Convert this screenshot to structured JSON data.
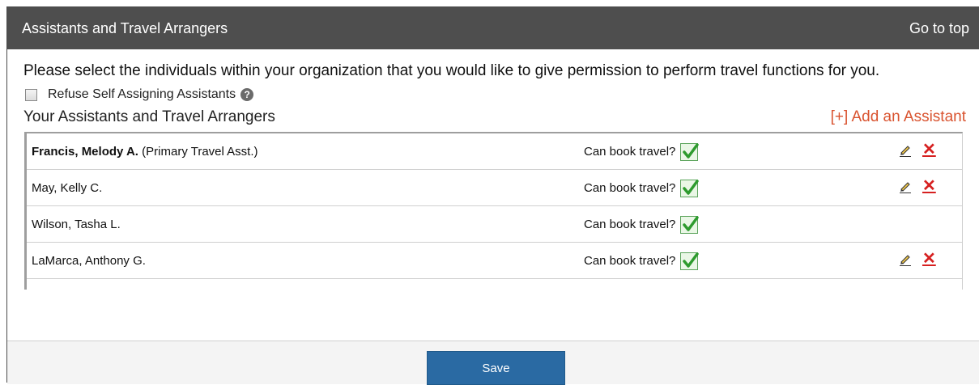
{
  "header": {
    "title": "Assistants and Travel Arrangers",
    "go_to_top": "Go to top"
  },
  "intro_text": "Please select the individuals within your organization that you would like to give permission to perform travel functions for you.",
  "refuse": {
    "label": "Refuse Self Assigning Assistants",
    "checked": false,
    "help_glyph": "?"
  },
  "section": {
    "title": "Your Assistants and Travel Arrangers",
    "add_link": "[+] Add an Assistant"
  },
  "assistants": [
    {
      "name": "Francis, Melody A.",
      "role": "(Primary Travel Asst.)",
      "can_book_label": "Can book travel?",
      "can_book": true,
      "editable": true
    },
    {
      "name": "May, Kelly C.",
      "role": "",
      "can_book_label": "Can book travel?",
      "can_book": true,
      "editable": true
    },
    {
      "name": "Wilson, Tasha L.",
      "role": "",
      "can_book_label": "Can book travel?",
      "can_book": true,
      "editable": false
    },
    {
      "name": "LaMarca, Anthony G.",
      "role": "",
      "can_book_label": "Can book travel?",
      "can_book": true,
      "editable": true
    }
  ],
  "icons": {
    "delete": "✕",
    "edit": "pencil-icon",
    "check": "checkmark-icon"
  },
  "footer": {
    "save_label": "Save"
  },
  "colors": {
    "header_bg": "#4e4e4e",
    "add_link": "#d9532f",
    "save_button": "#2a6aa3",
    "delete_icon": "#d62020",
    "check": "#2e9b2e"
  }
}
